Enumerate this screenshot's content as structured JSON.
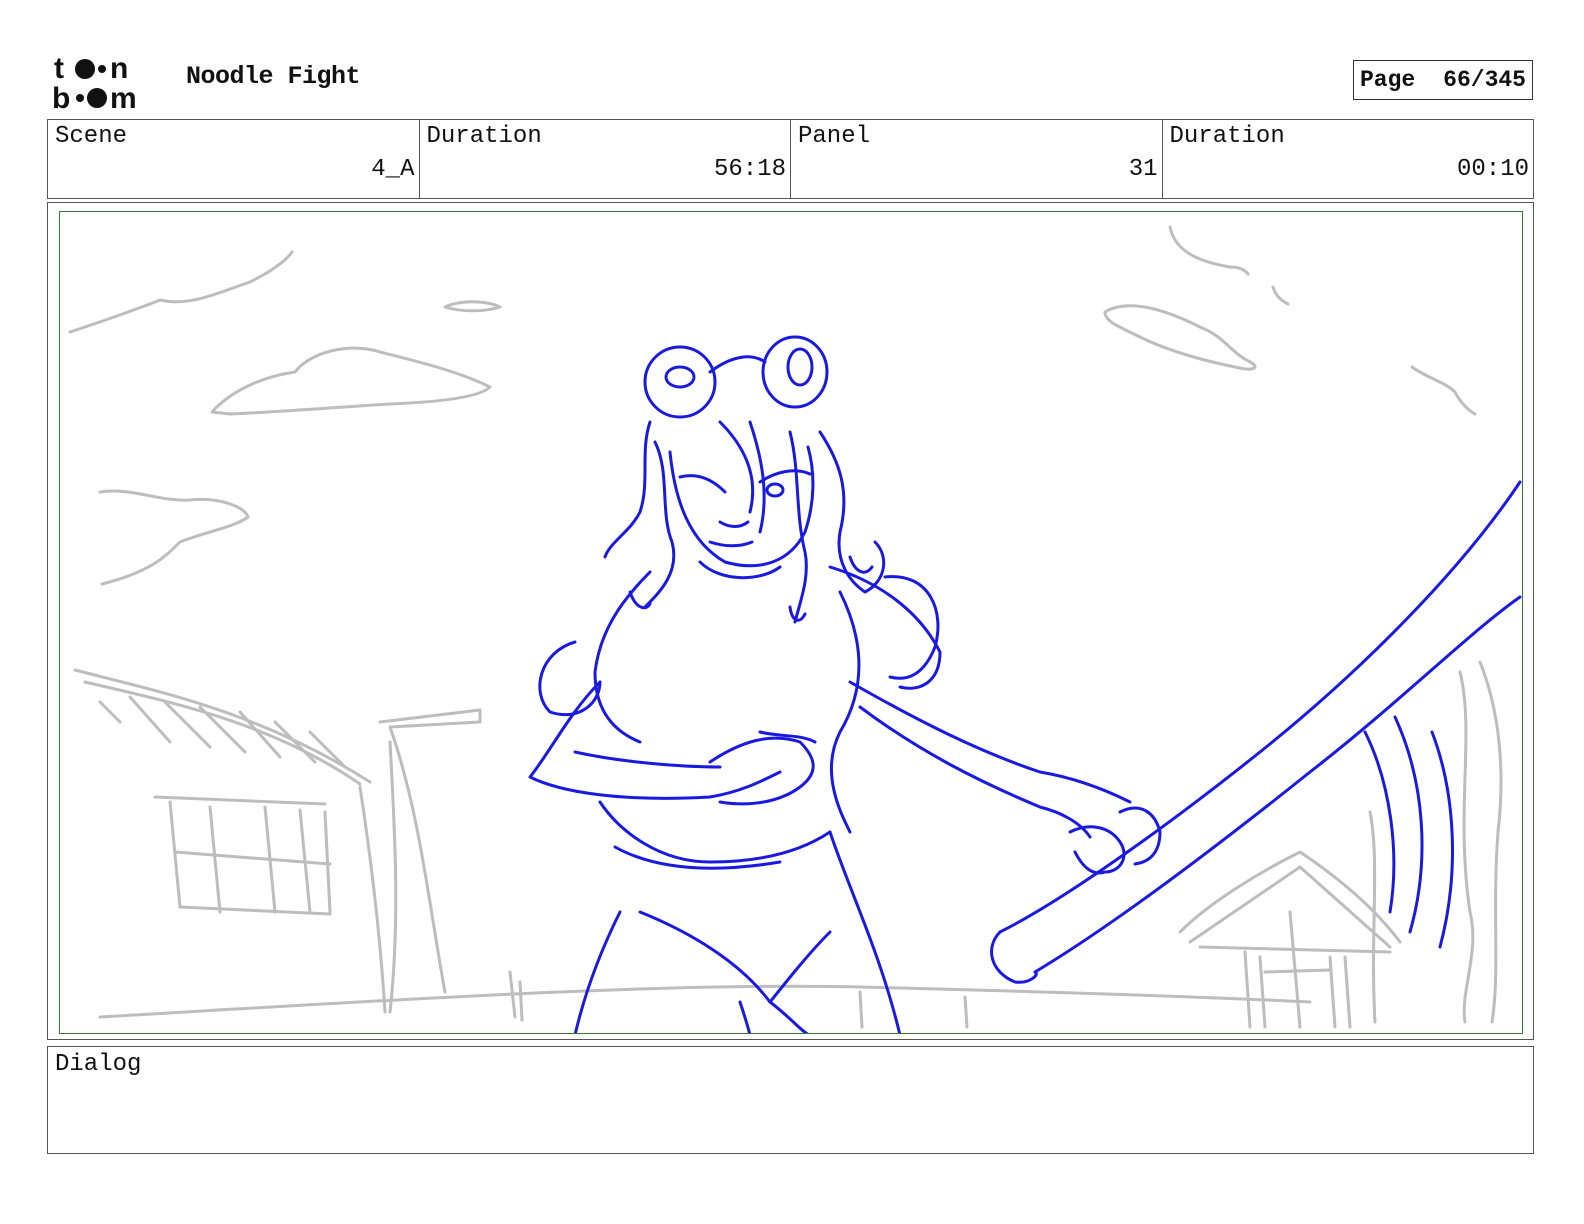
{
  "header": {
    "logo_text": "toon boom",
    "project_title": "Noodle Fight",
    "page_label": "Page",
    "page_number": "66/345"
  },
  "info": {
    "scene_label": "Scene",
    "scene_value": "4_A",
    "scene_duration_label": "Duration",
    "scene_duration_value": "56:18",
    "panel_label": "Panel",
    "panel_value": "31",
    "panel_duration_label": "Duration",
    "panel_duration_value": "00:10"
  },
  "dialog": {
    "label": "Dialog",
    "text": ""
  },
  "colors": {
    "sketch_primary": "#1a1adf",
    "sketch_background": "#bdbdbd",
    "frame_border": "#2e7d32"
  },
  "icons": {
    "logo": "toon-boom-logo"
  }
}
